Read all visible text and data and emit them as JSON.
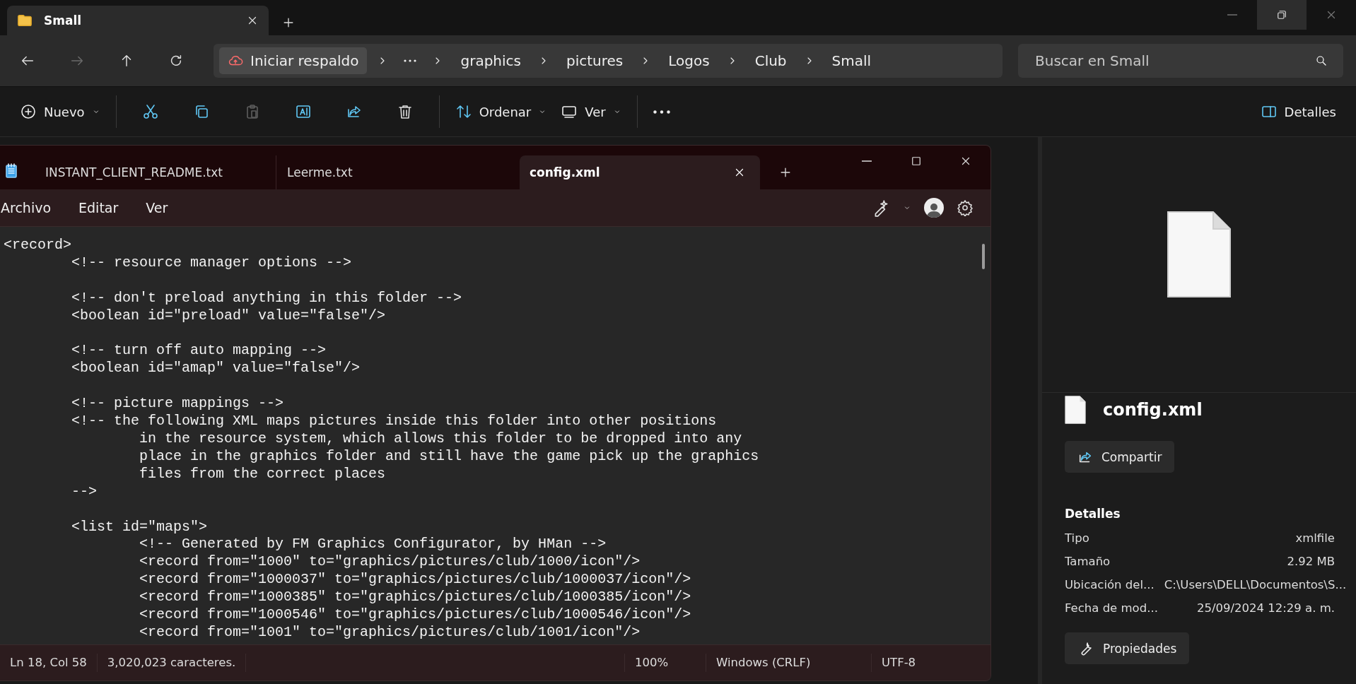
{
  "explorer": {
    "tab": {
      "title": "Small"
    },
    "nav_buttons": [
      {
        "kind": "back",
        "disabled": false
      },
      {
        "kind": "forward",
        "disabled": true
      },
      {
        "kind": "up",
        "disabled": false
      },
      {
        "kind": "refresh",
        "disabled": false
      }
    ],
    "address": {
      "backup_label": "Iniciar respaldo",
      "crumbs": [
        "graphics",
        "pictures",
        "Logos",
        "Club",
        "Small"
      ]
    },
    "search": {
      "placeholder": "Buscar en Small"
    },
    "toolbar": {
      "new_label": "Nuevo",
      "actions": [
        {
          "kind": "cut",
          "disabled": false
        },
        {
          "kind": "copy",
          "disabled": false
        },
        {
          "kind": "paste",
          "disabled": true
        },
        {
          "kind": "rename",
          "disabled": false
        },
        {
          "kind": "share",
          "disabled": false
        },
        {
          "kind": "delete",
          "disabled": false
        }
      ],
      "sort_label": "Ordenar",
      "view_label": "Ver",
      "details_label": "Detalles"
    },
    "details_pane": {
      "file_name": "config.xml",
      "share_label": "Compartir",
      "heading": "Detalles",
      "rows": [
        {
          "label": "Tipo",
          "value": "xmlfile"
        },
        {
          "label": "Tamaño",
          "value": "2.92 MB"
        },
        {
          "label": "Ubicación del...",
          "value": "C:\\Users\\DELL\\Documentos\\S..."
        },
        {
          "label": "Fecha de mod...",
          "value": "25/09/2024 12:29 a. m."
        }
      ],
      "properties_label": "Propiedades"
    }
  },
  "notepad": {
    "tabs": [
      {
        "label": "INSTANT_CLIENT_README.txt",
        "selected": false
      },
      {
        "label": "Leerme.txt",
        "selected": false
      },
      {
        "label": "config.xml",
        "selected": true
      }
    ],
    "menu": [
      "Archivo",
      "Editar",
      "Ver"
    ],
    "editor": {
      "text": "<record>\n\t<!-- resource manager options -->\n\n\t<!-- don't preload anything in this folder -->\n\t<boolean id=\"preload\" value=\"false\"/>\n\n\t<!-- turn off auto mapping -->\n\t<boolean id=\"amap\" value=\"false\"/>\n\n\t<!-- picture mappings -->\n\t<!-- the following XML maps pictures inside this folder into other positions\n\t\tin the resource system, which allows this folder to be dropped into any\n\t\tplace in the graphics folder and still have the game pick up the graphics\n\t\tfiles from the correct places\n\t-->\n\n\t<list id=\"maps\">\n\t\t<!-- Generated by FM Graphics Configurator, by HMan -->\n\t\t<record from=\"1000\" to=\"graphics/pictures/club/1000/icon\"/>\n\t\t<record from=\"1000037\" to=\"graphics/pictures/club/1000037/icon\"/>\n\t\t<record from=\"1000385\" to=\"graphics/pictures/club/1000385/icon\"/>\n\t\t<record from=\"1000546\" to=\"graphics/pictures/club/1000546/icon\"/>\n\t\t<record from=\"1001\" to=\"graphics/pictures/club/1001/icon\"/>"
    },
    "status": {
      "position": "Ln 18, Col 58",
      "characters": "3,020,023 caracteres.",
      "zoom": "100%",
      "line_endings": "Windows (CRLF)",
      "encoding": "UTF-8"
    }
  }
}
